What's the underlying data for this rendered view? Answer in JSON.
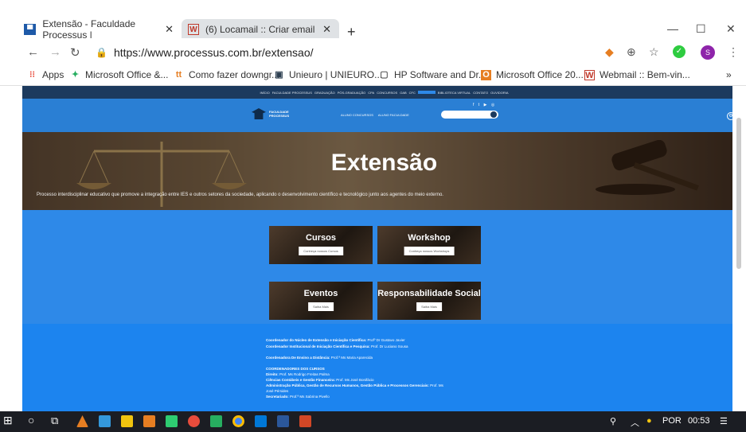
{
  "browser": {
    "tabs": [
      {
        "title": "Extensão - Faculdade Processus |",
        "favicon": "processus-favicon",
        "active": true
      },
      {
        "title": "(6) Locamail :: Criar email",
        "favicon": "locamail-favicon",
        "active": false
      }
    ],
    "close_glyph": "✕",
    "new_tab_glyph": "+",
    "url": "https://www.processus.com.br/extensao/",
    "bookmarks": [
      {
        "label": "Apps",
        "icon": "apps-grid-icon"
      },
      {
        "label": "Microsoft Office &...",
        "icon": "office-icon"
      },
      {
        "label": "Como fazer downgr...",
        "icon": "tt-icon"
      },
      {
        "label": "Unieuro | UNIEURO...",
        "icon": "unieuro-icon"
      },
      {
        "label": "HP Software and Dr...",
        "icon": "page-icon"
      },
      {
        "label": "Microsoft Office 20...",
        "icon": "office-orange-icon"
      },
      {
        "label": "Webmail :: Bem-vin...",
        "icon": "webmail-icon"
      }
    ],
    "bookmark_more": "»",
    "profile_initial": "S"
  },
  "site": {
    "topnav": [
      "INÍCIO",
      "FACULDADE PROCESSUS",
      "GRADUAÇÃO",
      "PÓS-GRADUAÇÃO",
      "CPA",
      "CONCURSOS",
      "OAB",
      "CFC",
      "BIBLIOTECA VIRTUAL",
      "CONTATO",
      "OUVIDORIA"
    ],
    "logo_text": "FACULDADE PROCESSUS",
    "header_links": [
      "ALUNO CONCURSOS",
      "ALUNO FACULDADE"
    ],
    "hero_title": "Extensão",
    "hero_subtitle": "Processo interdisciplinar educativo que promove a integração entre IES e outros setores da sociedade, aplicando o desenvolvimento científico e tecnológico junto aos agentes do meio externo.",
    "cards": [
      {
        "title": "Cursos",
        "button": "Conheça nossos Cursos"
      },
      {
        "title": "Workshop",
        "button": "Conheça nossos Workshops"
      },
      {
        "title": "Eventos",
        "button": "Saiba Mais"
      },
      {
        "title": "Responsabilidade Social",
        "button": "Saiba Mais"
      }
    ],
    "info": [
      {
        "label": "Coordenador do Núcleo de Extensão e Iniciação Científica:",
        "value": " Profº Dr Gustavo Javier"
      },
      {
        "label": "Coordenador Institucional de Iniciação Científica e Pesquisa:",
        "value": " Prof. Dr Luciano Sousa"
      },
      {
        "label": "Coordenadora De Ensino a Distância:",
        "value": " Prof.ª Ms Maria Aparecida"
      },
      {
        "label": "COORDENADORES DOS CURSOS",
        "value": ""
      },
      {
        "label": "Direito:",
        "value": " Prof. Ms Rodrigo Freitas Palma"
      },
      {
        "label": "Ciências Contábeis e Gestão Financeira:",
        "value": " Prof. Ms José Bonifácio"
      },
      {
        "label": "Administração Pública, Gestão de Recursos Humanos, Gestão Pública e Processos Gerenciais:",
        "value": " Prof. Ms"
      },
      {
        "label": "",
        "value": "José Pérsides"
      },
      {
        "label": "Secretariado:",
        "value": " Prof.ª Ms Sabrina Pivello"
      }
    ]
  },
  "taskbar": {
    "language": "POR",
    "time": "00:53"
  }
}
